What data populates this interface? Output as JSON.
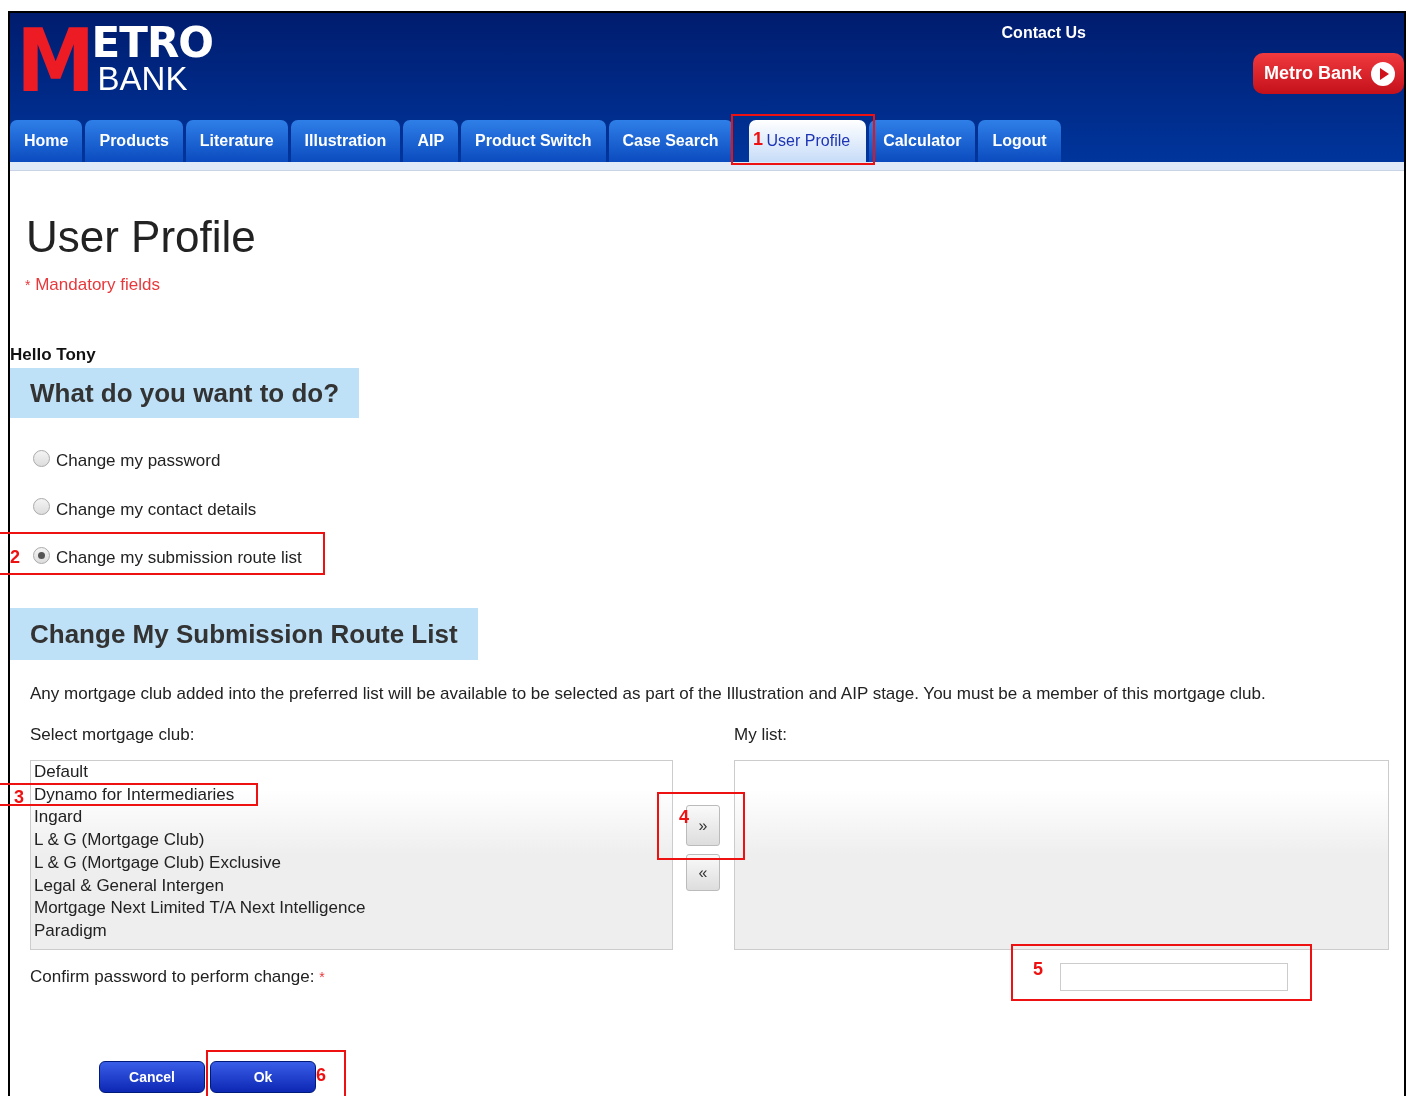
{
  "logo": {
    "initial": "M",
    "line1": "ETRO",
    "line2": "BANK"
  },
  "header": {
    "contact_link": "Contact Us",
    "bank_button": "Metro Bank"
  },
  "tabs": [
    {
      "label": "Home",
      "selected": false
    },
    {
      "label": "Products",
      "selected": false
    },
    {
      "label": "Literature",
      "selected": false
    },
    {
      "label": "Illustration",
      "selected": false
    },
    {
      "label": "AIP",
      "selected": false
    },
    {
      "label": "Product Switch",
      "selected": false
    },
    {
      "label": "Case Search",
      "selected": false
    },
    {
      "label": "User Profile",
      "selected": true
    },
    {
      "label": "Calculator",
      "selected": false
    },
    {
      "label": "Logout",
      "selected": false
    }
  ],
  "page_title": "User Profile",
  "mandatory_note": {
    "mark": "*",
    "text": "Mandatory fields"
  },
  "greeting": "Hello Tony",
  "section_1": {
    "heading": "What do you want to do?",
    "options": [
      {
        "label": "Change my password",
        "selected": false
      },
      {
        "label": "Change my contact details",
        "selected": false
      },
      {
        "label": "Change my submission route list",
        "selected": true
      }
    ]
  },
  "section_2": {
    "heading": "Change My Submission Route List",
    "description": "Any mortgage club added into the preferred list will be available to be selected as part of the Illustration and AIP stage. You must be a member of this mortgage club.",
    "select_label": "Select mortgage club:",
    "my_list_label": "My list:",
    "clubs": [
      "Default",
      "Dynamo for Intermediaries",
      "Ingard",
      "L & G (Mortgage Club)",
      "L & G (Mortgage Club) Exclusive",
      "Legal & General Intergen",
      "Mortgage Next Limited T/A Next Intelligence",
      "Paradigm"
    ],
    "add_button": "»",
    "remove_button": "«",
    "password_label": "Confirm password to perform change:",
    "password_required": "*"
  },
  "buttons": [
    "Cancel",
    "Ok"
  ],
  "annotations": [
    "1",
    "2",
    "3",
    "4",
    "5",
    "6"
  ]
}
